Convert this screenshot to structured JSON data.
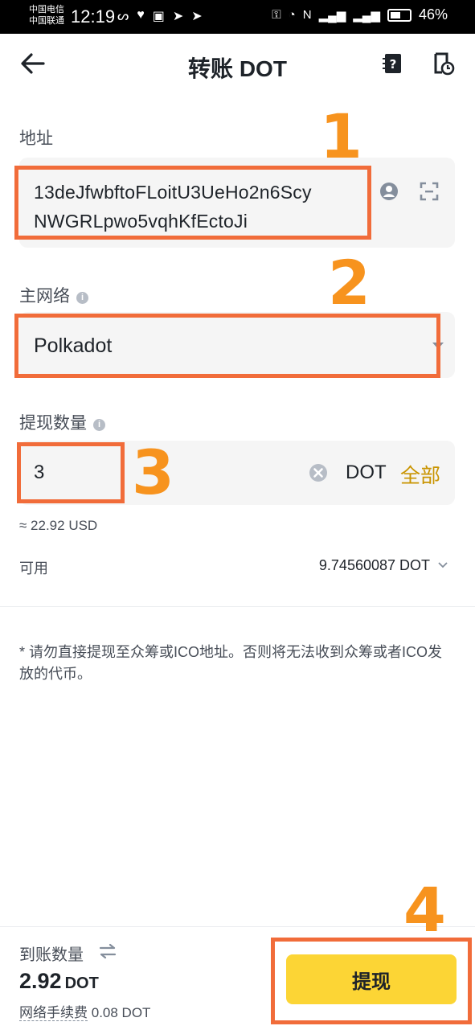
{
  "status_bar": {
    "carrier_1": "中国电信",
    "carrier_2": "中国联通",
    "time": "12:19",
    "battery": "46%"
  },
  "header": {
    "title": "转账 DOT",
    "left_icon": "back-arrow-icon",
    "right_icons": [
      "faq-icon",
      "history-icon"
    ]
  },
  "address": {
    "label": "地址",
    "line1": "13deJfwbftoFLoitU3UeHo2n6Scy",
    "line2": "NWGRLpwo5vqhKfEctoJi"
  },
  "network": {
    "label": "主网络",
    "value": "Polkadot"
  },
  "amount": {
    "label": "提现数量",
    "value": "3",
    "unit": "DOT",
    "max_label": "全部",
    "usd_estimate": "≈ 22.92 USD"
  },
  "available": {
    "label": "可用",
    "value": "9.74560087 DOT"
  },
  "notice": "* 请勿直接提现至众筹或ICO地址。否则将无法收到众筹或者ICO发放的代币。",
  "footer": {
    "receive_label": "到账数量",
    "receive_amount": "2.92",
    "receive_unit": "DOT",
    "fee_label": "网络手续费",
    "fee_value": "0.08 DOT",
    "submit_label": "提现"
  },
  "annotations": {
    "step1": "1",
    "step2": "2",
    "step3": "3",
    "step4": "4",
    "highlight_color": "#f16c3a",
    "number_color": "#f7931e"
  },
  "colors": {
    "accent": "#fcd535",
    "link": "#c99400"
  }
}
